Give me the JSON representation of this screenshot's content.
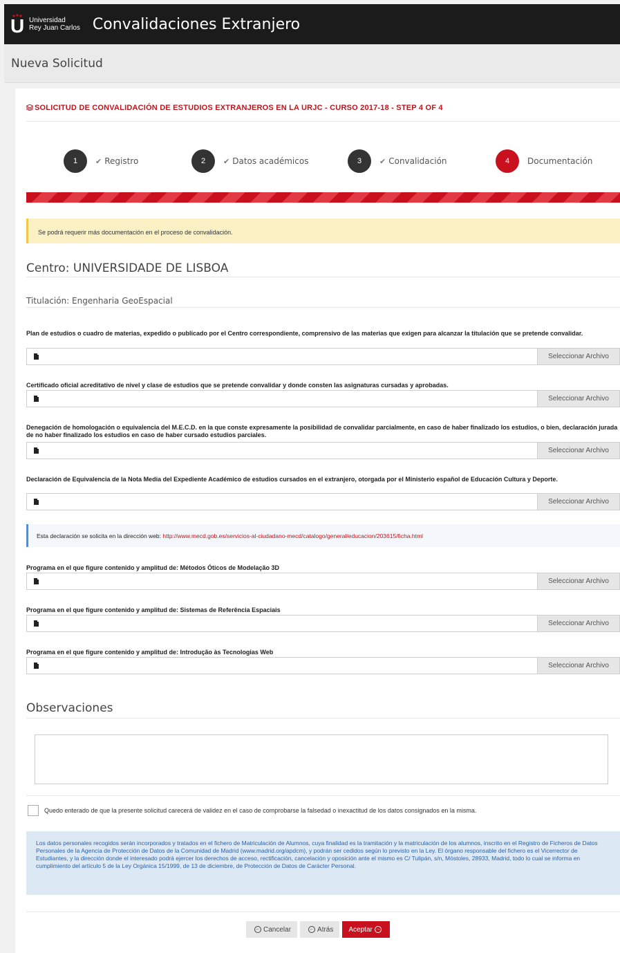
{
  "header": {
    "logo_letter": "U",
    "university_line1": "Universidad",
    "university_line2": "Rey Juan Carlos",
    "app_title": "Convalidaciones Extranjero"
  },
  "subheader": {
    "title": "Nueva Solicitud"
  },
  "form": {
    "title": "SOLICITUD DE CONVALIDACIÓN DE ESTUDIOS EXTRANJEROS EN LA URJC - CURSO 2017-18 - STEP 4 OF 4",
    "steps": [
      {
        "number": "1",
        "label": "Registro",
        "done": true
      },
      {
        "number": "2",
        "label": "Datos académicos",
        "done": true
      },
      {
        "number": "3",
        "label": "Convalidación",
        "done": true
      },
      {
        "number": "4",
        "label": "Documentación",
        "done": false
      }
    ],
    "warning": "Se podrá requerir más documentación en el proceso de convalidación.",
    "centro": "Centro: UNIVERSIDADE DE LISBOA",
    "titulacion": "Titulación: Engenharia GeoEspacial",
    "select_file_label": "Seleccionar Archivo",
    "documents": [
      {
        "label": "Plan de estudios o cuadro de materias, expedido o publicado por el Centro correspondiente, comprensivo de las materias que exigen para alcanzar la titulación que se pretende convalidar."
      },
      {
        "label": "Certificado oficial acreditativo de nivel y clase de estudios que se pretende convalidar y donde consten las asignaturas cursadas y aprobadas."
      },
      {
        "label": "Denegación de homologación o equivalencia del M.E.C.D. en la que conste expresamente la posibilidad de convalidar parcialmente, en caso de haber finalizado los estudios, o bien, declaración jurada de no haber finalizado los estudios en caso de haber cursado estudios parciales."
      },
      {
        "label": "Declaración de Equivalencia de la Nota Media del Expediente Académico de estudios cursados en el extranjero, otorgada por el Ministerio español de Educación Cultura y Deporte."
      },
      {
        "label": "Programa en el que figure contenido y amplitud de: Métodos Óticos de Modelação 3D"
      },
      {
        "label": "Programa en el que figure contenido y amplitud de: Sistemas de Referência Espaciais"
      },
      {
        "label": "Programa en el que figure contenido y amplitud de: Introdução às Tecnologias Web"
      }
    ],
    "info_text": "Esta declaración se solicita en la dirección web: ",
    "info_link": "http://www.mecd.gob.es/servicios-al-ciudadano-mecd/catalogo/general/educacion/203615/ficha.html",
    "observaciones_title": "Observaciones",
    "observaciones_value": "",
    "consent_text": "Quedo enterado de que la presente solicitud carecerá de validez en el caso de comprobarse la falsedad o inexactitud de los datos consignados en la misma.",
    "legal_text": "Los datos personales recogidos serán incorporados y tratados en el fichero de Matriculación de Alumnos, cuya finalidad es la tramitación y la matriculación de los alumnos, inscrito en el Registro de Ficheros de Datos Personales de la Agencia de Protección de Datos de la Comunidad de Madrid (www.madrid.org/apdcm), y podrán ser cedidos según lo previsto en la Ley. El órgano responsable del fichero es el Vicerrector de Estudiantes, y la dirección donde el interesado podrá ejercer los derechos de acceso, rectificación, cancelación y oposición ante el mismo es C/ Tulipán, s/n, Móstoles, 28933, Madrid, todo lo cual se informa en cumplimiento del artículo 5 de la Ley Orgánica 15/1999, de 13 de diciembre, de Protección de Datos de Carácter Personal.",
    "buttons": {
      "cancel": "Cancelar",
      "back": "Atrás",
      "accept": "Aceptar"
    }
  },
  "colors": {
    "brand_red": "#c8101e",
    "header_bg": "#1b1b1b",
    "warning_bg": "#fcf1c4",
    "legal_bg": "#dde8f5"
  }
}
